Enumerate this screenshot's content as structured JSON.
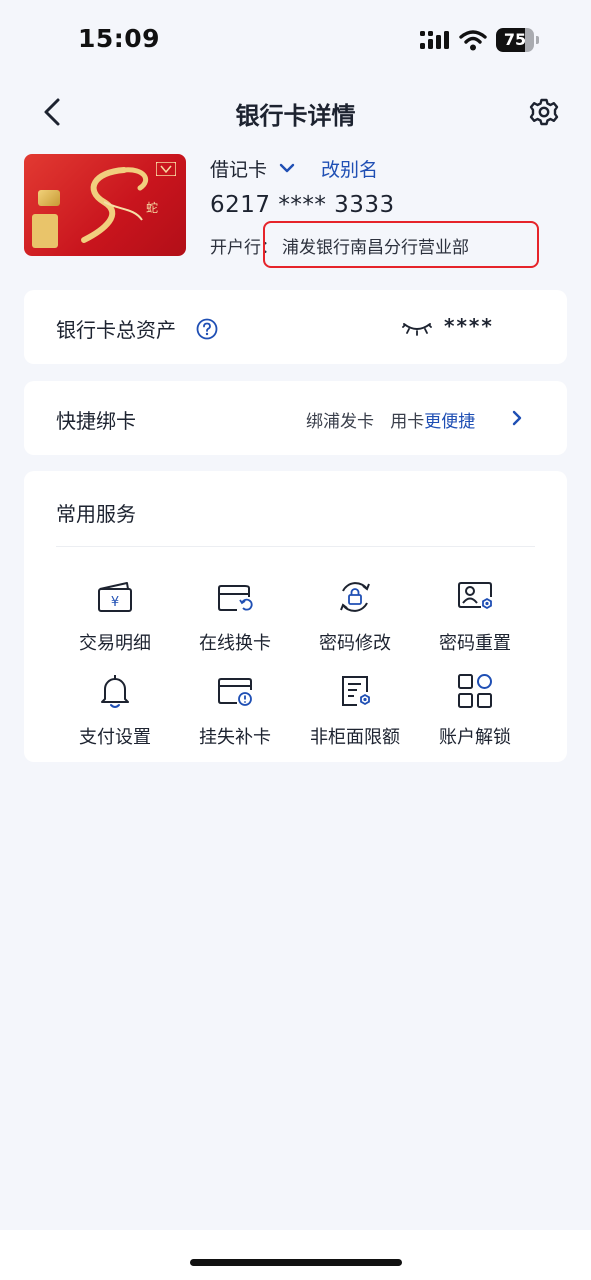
{
  "status_bar": {
    "time": "15:09",
    "battery_percent": 75,
    "battery_label": "75"
  },
  "nav": {
    "title": "银行卡详情",
    "back_icon": "chevron-left-icon",
    "settings_icon": "gear-icon"
  },
  "card": {
    "type": "借记卡",
    "rename_label": "改别名",
    "number": "6217 **** 3333",
    "branch_label": "开户行：",
    "branch_name": "浦发银行南昌分行营业部",
    "card_color": "#d41b22",
    "highlight_color": "#e6242a"
  },
  "assets": {
    "label": "银行卡总资产",
    "value": "****"
  },
  "quick_bind": {
    "label": "快捷绑卡",
    "desc_plain": "绑浦发卡   用卡",
    "desc_blue": "更便捷"
  },
  "services": {
    "title": "常用服务",
    "items": [
      {
        "label": "交易明细",
        "icon": "wallet-yuan-icon"
      },
      {
        "label": "在线换卡",
        "icon": "card-refresh-icon"
      },
      {
        "label": "密码修改",
        "icon": "lock-refresh-icon"
      },
      {
        "label": "密码重置",
        "icon": "id-card-settings-icon"
      },
      {
        "label": "支付设置",
        "icon": "bell-icon"
      },
      {
        "label": "挂失补卡",
        "icon": "card-alert-icon"
      },
      {
        "label": "非柜面限额",
        "icon": "document-settings-icon"
      },
      {
        "label": "账户解锁",
        "icon": "grid-apps-icon"
      }
    ]
  },
  "colors": {
    "accent": "#1f4fb4",
    "background": "#f4f6fb",
    "icon_stroke": "#1d2330"
  }
}
